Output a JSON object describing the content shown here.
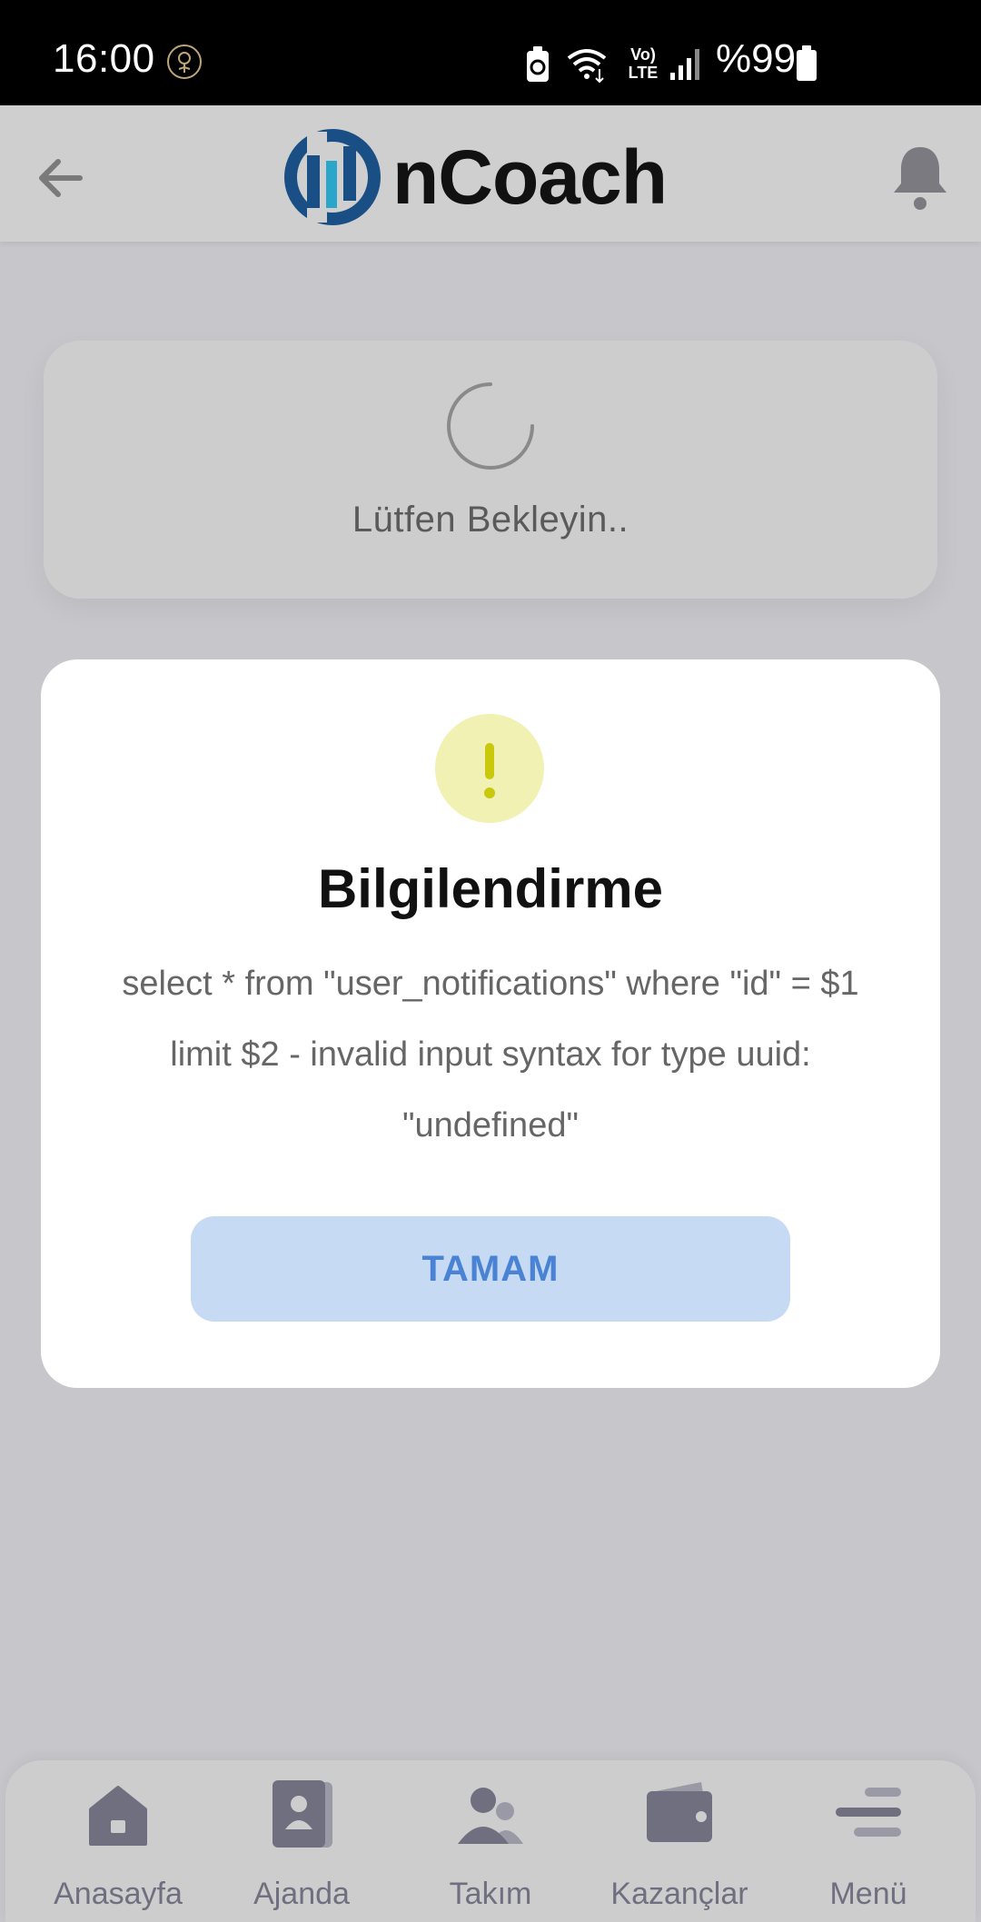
{
  "status_bar": {
    "time": "16:00",
    "network": "Vo) LTE",
    "battery": "%99"
  },
  "header": {
    "logo_text": "nCoach",
    "back_icon": "arrow-left-icon",
    "notification_icon": "bell-icon"
  },
  "loading": {
    "text": "Lütfen Bekleyin.."
  },
  "dialog": {
    "title": "Bilgilendirme",
    "message": "select * from \"user_notifications\" where \"id\" = $1 limit $2 - invalid input syntax for type uuid: \"undefined\"",
    "ok_label": "TAMAM",
    "icon": "exclamation-icon"
  },
  "bottom_nav": {
    "items": [
      {
        "label": "Anasayfa",
        "icon": "home-icon"
      },
      {
        "label": "Ajanda",
        "icon": "contact-book-icon"
      },
      {
        "label": "Takım",
        "icon": "team-icon"
      },
      {
        "label": "Kazançlar",
        "icon": "wallet-icon"
      },
      {
        "label": "Menü",
        "icon": "menu-icon"
      }
    ]
  },
  "colors": {
    "brand_blue": "#1a4f86",
    "brand_cyan": "#29a6c9",
    "button_bg": "#c7daf3",
    "button_text": "#4a82d4",
    "alert_bg": "#f0f1b3",
    "alert_fg": "#c9c80a",
    "nav_icon": "#6f6f80"
  }
}
